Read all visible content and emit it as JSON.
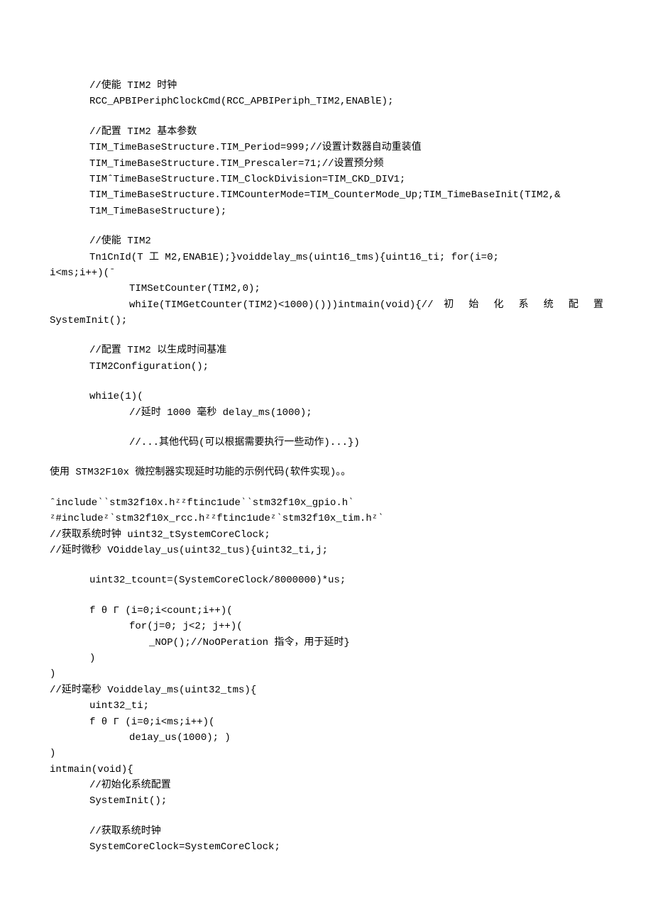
{
  "lines": [
    {
      "cls": "indent1",
      "t": "//使能 TIM2 时钟"
    },
    {
      "cls": "indent1",
      "t": "RCC_APBIPeriphClockCmd(RCC_APBIPeriph_TIM2,ENABlE);"
    },
    {
      "cls": "blank",
      "t": ""
    },
    {
      "cls": "indent1",
      "t": "//配置 TIM2 基本参数"
    },
    {
      "cls": "indent1",
      "t": "TIM_TimeBaseStructure.TIM_Period=999;//设置计数器自动重装值"
    },
    {
      "cls": "indent1",
      "t": "TIM_TimeBaseStructure.TIM_Prescaler=71;//设置预分频"
    },
    {
      "cls": "indent1",
      "t": "TIMˆTimeBaseStructure.TIM_ClockDivision=TIM_CKD_DIV1;"
    },
    {
      "cls": "indent1",
      "t": "TIM_TimeBaseStructure.TIMCounterMode=TIM_CounterMode_Up;TIM_TimeBaseInit(TIM2,&"
    },
    {
      "cls": "indent1",
      "t": "T1M_TimeBaseStructure);"
    },
    {
      "cls": "blank",
      "t": ""
    },
    {
      "cls": "indent1",
      "t": "//使能 TIM2"
    },
    {
      "cls": "indent1",
      "t": "Tn1CnId(T 工 M2,ENAB1E);}voiddelay_ms(uint16_tms){uint16_ti; for(i=0;",
      "underlineWord": "or"
    },
    {
      "cls": "",
      "t": "i<ms;i++)(ˉ"
    },
    {
      "cls": "indent2",
      "t": "TIMSetCounter(TIM2,0);"
    },
    {
      "cls": "indent2 justified",
      "t": "whiIe(TIMGetCounter(TIM2)<1000)()))intmain(void){// 初 始 化 系 统 配 置"
    },
    {
      "cls": "",
      "t": "SystemInit();"
    },
    {
      "cls": "blank",
      "t": ""
    },
    {
      "cls": "indent1",
      "t": "//配置 TIM2 以生成时间基准"
    },
    {
      "cls": "indent1",
      "t": "TIM2Configuration();"
    },
    {
      "cls": "blank",
      "t": ""
    },
    {
      "cls": "indent1",
      "t": "whi1e(1)("
    },
    {
      "cls": "indent2",
      "t": "//延时 1000 毫秒 delay_ms(1000);"
    },
    {
      "cls": "blank",
      "t": ""
    },
    {
      "cls": "indent2",
      "t": "//...其他代码(可以根据需要执行一些动作)...})"
    },
    {
      "cls": "blank",
      "t": ""
    },
    {
      "cls": "",
      "t": "使用 STM32F10x 微控制器实现延时功能的示例代码(软件实现)。。"
    },
    {
      "cls": "blank",
      "t": ""
    },
    {
      "cls": "",
      "t": "ˆinclude‵‵stm32f10x.hᶻᶻftinc1ude‵‵stm32f10x_gpio.h‵"
    },
    {
      "cls": "",
      "t": "ᶻ#includeᶻ‵stm32f10x_rcc.hᶻᶻftinc1udeᶻ‵stm32f10x_tim.hᶻ‵"
    },
    {
      "cls": "",
      "t": "//获取系统时钟 uint32_tSystemCoreClock;"
    },
    {
      "cls": "",
      "t": "//延时微秒 VOiddelay_us(uint32_tus){uint32_ti,j;"
    },
    {
      "cls": "blank",
      "t": ""
    },
    {
      "cls": "indent1",
      "t": "uint32_tcount=(SystemCoreClock/8000000)*us;"
    },
    {
      "cls": "blank",
      "t": ""
    },
    {
      "cls": "indent1",
      "t": "f θ Γ (i=0;i<count;i++)("
    },
    {
      "cls": "indent2",
      "t": "for(j=0; j<2; j++)("
    },
    {
      "cls": "indent3",
      "t": "_NOP();//NoOPeration 指令，用于延时}"
    },
    {
      "cls": "indent1",
      "t": ")"
    },
    {
      "cls": "",
      "t": ")"
    },
    {
      "cls": "",
      "t": "//延时毫秒 Voiddelay_ms(uint32_tms){"
    },
    {
      "cls": "indent1",
      "t": "uint32_ti;"
    },
    {
      "cls": "indent1",
      "t": "f θ Γ (i=0;i<ms;i++)("
    },
    {
      "cls": "indent2",
      "t": "de1ay_us(1000); )"
    },
    {
      "cls": "",
      "t": ")"
    },
    {
      "cls": "",
      "t": "intmain(void){"
    },
    {
      "cls": "indent1",
      "t": "//初始化系统配置"
    },
    {
      "cls": "indent1",
      "t": "SystemInit();"
    },
    {
      "cls": "blank",
      "t": ""
    },
    {
      "cls": "indent1",
      "t": "//获取系统时钟"
    },
    {
      "cls": "indent1",
      "t": "SystemCoreClock=SystemCoreClock;"
    }
  ]
}
